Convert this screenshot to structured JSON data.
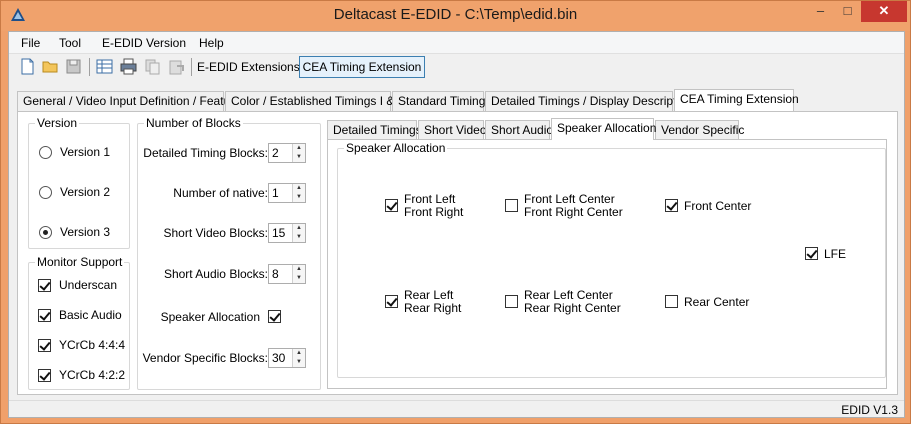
{
  "window": {
    "title": "Deltacast E-EDID - C:\\Temp\\edid.bin",
    "controls": {
      "minimize": "–",
      "maximize": "□",
      "close": "✕"
    }
  },
  "menu": {
    "items": [
      {
        "label": "File"
      },
      {
        "label": "Tool"
      },
      {
        "label": "E-EDID Version"
      },
      {
        "label": "Help"
      }
    ]
  },
  "toolbar": {
    "icons": [
      "new-file-icon",
      "open-folder-icon",
      "save-icon",
      "table-icon",
      "print-icon",
      "copy-icon",
      "paste-icon"
    ],
    "extensions_label": "E-EDID Extensions:",
    "extension_button": "CEA Timing Extension"
  },
  "main_tabs": [
    {
      "label": "General / Video Input Definition / Feature",
      "active": false
    },
    {
      "label": "Color / Established Timings I & II",
      "active": false
    },
    {
      "label": "Standard Timings",
      "active": false
    },
    {
      "label": "Detailed Timings / Display Descriptors",
      "active": false
    },
    {
      "label": "CEA Timing Extension",
      "active": true
    }
  ],
  "version_group": {
    "title": "Version",
    "options": [
      {
        "label": "Version 1",
        "selected": false
      },
      {
        "label": "Version 2",
        "selected": false
      },
      {
        "label": "Version 3",
        "selected": true
      }
    ]
  },
  "monitor_support": {
    "title": "Monitor Support",
    "options": [
      {
        "label": "Underscan",
        "checked": true
      },
      {
        "label": "Basic Audio",
        "checked": true
      },
      {
        "label": "YCrCb 4:4:4",
        "checked": true
      },
      {
        "label": "YCrCb 4:2:2",
        "checked": true
      }
    ]
  },
  "blocks": {
    "title": "Number of Blocks",
    "detailed_timing": {
      "label": "Detailed Timing Blocks:",
      "value": "2"
    },
    "native": {
      "label": "Number of native:",
      "value": "1"
    },
    "short_video": {
      "label": "Short Video Blocks:",
      "value": "15"
    },
    "short_audio": {
      "label": "Short Audio Blocks:",
      "value": "8"
    },
    "speaker_allocation": {
      "label": "Speaker Allocation",
      "checked": true
    },
    "vendor_specific": {
      "label": "Vendor Specific Blocks:",
      "value": "30"
    }
  },
  "inner_tabs": [
    {
      "label": "Detailed Timings",
      "active": false
    },
    {
      "label": "Short Video",
      "active": false
    },
    {
      "label": "Short Audio",
      "active": false
    },
    {
      "label": "Speaker Allocation",
      "active": true
    },
    {
      "label": "Vendor Specific",
      "active": false
    }
  ],
  "speaker_allocation": {
    "title": "Speaker Allocation",
    "front_lr": {
      "line1": "Front Left",
      "line2": "Front Right",
      "checked": true
    },
    "front_lrc": {
      "line1": "Front Left Center",
      "line2": "Front Right Center",
      "checked": false
    },
    "front_center": {
      "label": "Front Center",
      "checked": true
    },
    "lfe": {
      "label": "LFE",
      "checked": true
    },
    "rear_lr": {
      "line1": "Rear Left",
      "line2": "Rear Right",
      "checked": true
    },
    "rear_lrc": {
      "line1": "Rear Left Center",
      "line2": "Rear Right Center",
      "checked": false
    },
    "rear_center": {
      "label": "Rear Center",
      "checked": false
    }
  },
  "status": {
    "version": "EDID V1.3"
  },
  "colors": {
    "titlebar": "#f0a26c",
    "close_button": "#c7372f",
    "accent_button": "#e5f1fb"
  }
}
